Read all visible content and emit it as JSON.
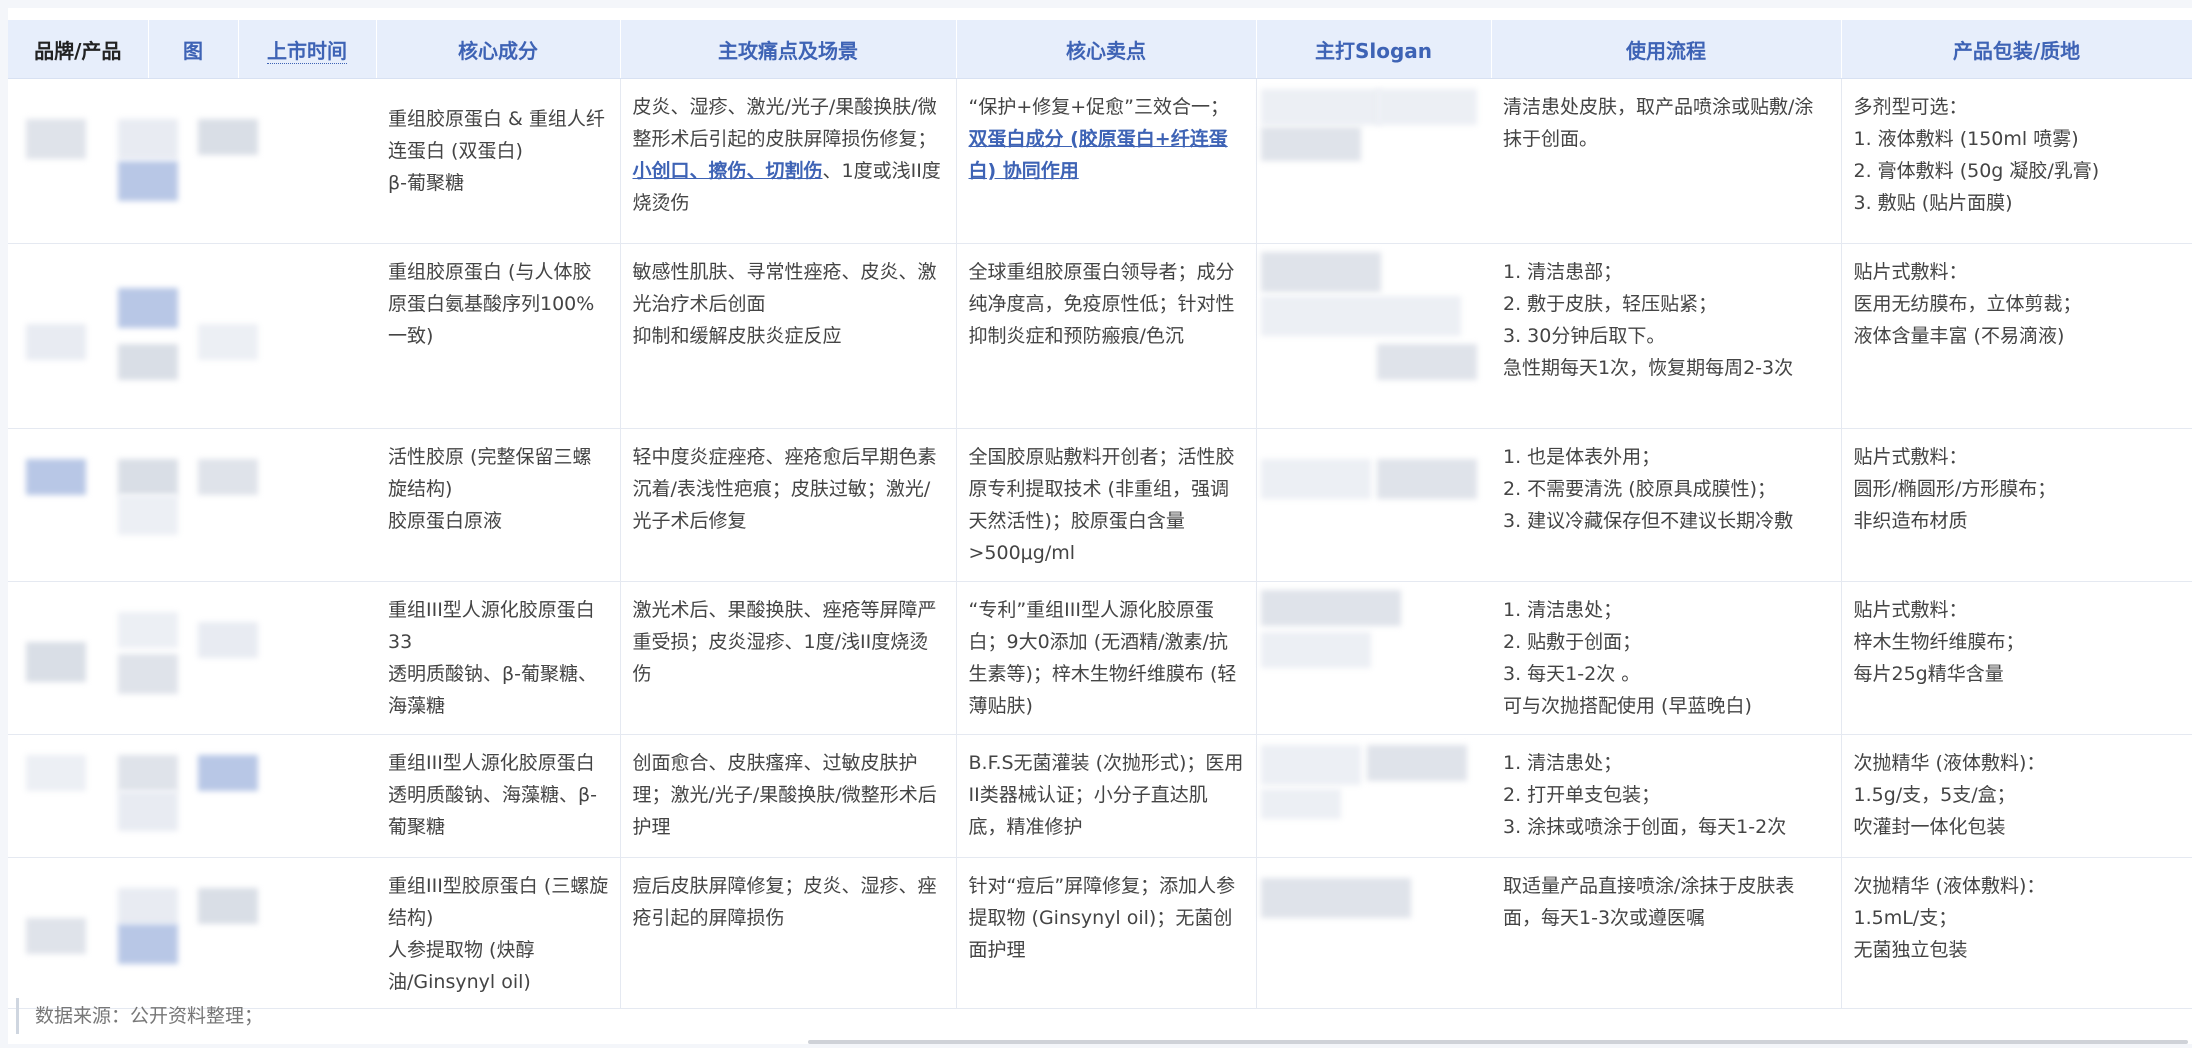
{
  "headers": {
    "brand": "品牌/产品",
    "image": "图",
    "date": "上市时间",
    "ingredients": "核心成分",
    "scenarios": "主攻痛点及场景",
    "selling": "核心卖点",
    "slogan": "主打Slogan",
    "usage": "使用流程",
    "packaging": "产品包装/质地"
  },
  "rows": [
    {
      "ingredients": [
        "重组胶原蛋白 & 重组人纤连蛋白 (双蛋白)",
        "β-葡聚糖"
      ],
      "scenarios": {
        "before": "皮炎、湿疹、激光/光子/果酸换肤/微整形术后引起的皮肤屏障损伤修复；",
        "link": "小创口、擦伤、切割伤",
        "after": "、1度或浅II度烧烫伤"
      },
      "selling": {
        "before": "“保护+修复+促愈”三效合一；",
        "link": "双蛋白成分 (胶原蛋白+纤连蛋白) 协同作用",
        "after": ""
      },
      "usage": [
        "清洁患处皮肤，取产品喷涂或贴敷/涂抹于创面。"
      ],
      "packaging": [
        "多剂型可选：",
        "1. 液体敷料 (150ml 喷雾)",
        "2. 膏体敷料 (50g 凝胶/乳膏)",
        "3. 敷贴 (贴片面膜)"
      ]
    },
    {
      "ingredients": [
        "重组胶原蛋白 (与人体胶原蛋白氨基酸序列100%一致)"
      ],
      "scenarios": {
        "before": "敏感性肌肤、寻常性痤疮、皮炎、激光治疗术后创面",
        "link": "",
        "after": ""
      },
      "scenarios_extra": "抑制和缓解皮肤炎症反应",
      "selling": {
        "before": "全球重组胶原蛋白领导者；成分纯净度高，免疫原性低；针对性抑制炎症和预防瘢痕/色沉",
        "link": "",
        "after": ""
      },
      "usage": [
        "1. 清洁患部；",
        "2. 敷于皮肤，轻压贴紧；",
        "3. 30分钟后取下。",
        "急性期每天1次，恢复期每周2-3次"
      ],
      "packaging": [
        "贴片式敷料：",
        "医用无纺膜布，立体剪裁；",
        "液体含量丰富 (不易滴液)"
      ]
    },
    {
      "ingredients": [
        "活性胶原 (完整保留三螺旋结构)",
        "胶原蛋白原液"
      ],
      "scenarios": {
        "before": "轻中度炎症痤疮、痤疮愈后早期色素沉着/表浅性疤痕；皮肤过敏；激光/光子术后修复",
        "link": "",
        "after": ""
      },
      "selling": {
        "before": "全国胶原贴敷料开创者；活性胶原专利提取技术 (非重组，强调天然活性)；胶原蛋白含量>500μg/ml",
        "link": "",
        "after": ""
      },
      "usage": [
        "1. 也是体表外用；",
        "2. 不需要清洗 (胶原具成膜性)；",
        "3. 建议冷藏保存但不建议长期冷敷"
      ],
      "packaging": [
        "贴片式敷料：",
        "圆形/椭圆形/方形膜布；",
        "非织造布材质"
      ]
    },
    {
      "ingredients": [
        "重组III型人源化胶原蛋白 33",
        "透明质酸钠、β-葡聚糖、海藻糖"
      ],
      "scenarios": {
        "before": "激光术后、果酸换肤、痤疮等屏障严重受损；皮炎湿疹、1度/浅II度烧烫伤",
        "link": "",
        "after": ""
      },
      "selling": {
        "before": "“专利”重组III型人源化胶原蛋白；9大0添加 (无酒精/激素/抗生素等)；梓木生物纤维膜布 (轻薄贴肤)",
        "link": "",
        "after": ""
      },
      "usage": [
        "1. 清洁患处；",
        "2. 贴敷于创面；",
        "3. 每天1-2次 。",
        "可与次抛搭配使用 (早蓝晚白)"
      ],
      "packaging": [
        "贴片式敷料：",
        "梓木生物纤维膜布；",
        "每片25g精华含量"
      ]
    },
    {
      "ingredients": [
        "重组III型人源化胶原蛋白",
        "透明质酸钠、海藻糖、β-葡聚糖"
      ],
      "scenarios": {
        "before": "创面愈合、皮肤瘙痒、过敏皮肤护理；激光/光子/果酸换肤/微整形术后护理",
        "link": "",
        "after": ""
      },
      "selling": {
        "before": "B.F.S无菌灌装 (次抛形式)；医用II类器械认证；小分子直达肌底，精准修护",
        "link": "",
        "after": ""
      },
      "usage": [
        "1. 清洁患处；",
        "2. 打开单支包装；",
        "3. 涂抹或喷涂于创面，每天1-2次"
      ],
      "packaging": [
        "次抛精华 (液体敷料)：",
        "1.5g/支，5支/盒；",
        "吹灌封一体化包装"
      ]
    },
    {
      "ingredients": [
        "重组III型胶原蛋白 (三螺旋结构)",
        "人参提取物 (炔醇油/Ginsynyl oil)"
      ],
      "scenarios": {
        "before": "痘后皮肤屏障修复；皮炎、湿疹、痤疮引起的屏障损伤",
        "link": "",
        "after": ""
      },
      "selling": {
        "before": "针对“痘后”屏障修复；添加人参提取物 (Ginsynyl oil)；无菌创面护理",
        "link": "",
        "after": ""
      },
      "usage": [
        "取适量产品直接喷涂/涂抹于皮肤表面，每天1-3次或遵医嘱"
      ],
      "packaging": [
        "次抛精华 (液体敷料)：",
        "1.5mL/支；",
        "无菌独立包装"
      ]
    }
  ],
  "footer": {
    "source": "数据来源：公开资料整理；"
  },
  "colors": {
    "header_bg": "#e7eefb",
    "header_text": "#3e63b5",
    "link": "#3e63b5"
  }
}
